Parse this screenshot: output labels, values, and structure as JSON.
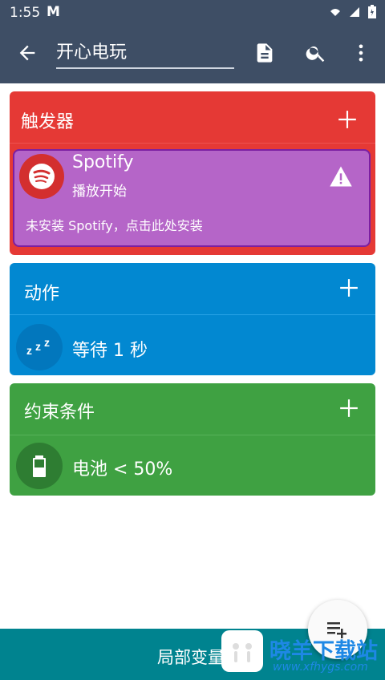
{
  "status_bar": {
    "time": "1:55",
    "app_glyph": "M"
  },
  "app_bar": {
    "title": "开心电玩",
    "icons": [
      "back-arrow-icon",
      "document-icon",
      "search-icon",
      "more-vert-icon"
    ]
  },
  "triggers": {
    "header": "触发器",
    "item": {
      "title": "Spotify",
      "subtitle": "播放开始",
      "note": "未安装 Spotify，点击此处安装",
      "color": "#b565c8"
    }
  },
  "actions": {
    "header": "动作",
    "item": {
      "label": "等待 1 秒",
      "icon": "sleep-zzz-icon"
    }
  },
  "constraints": {
    "header": "约束条件",
    "item": {
      "label": "电池 < 50%",
      "icon": "battery-icon"
    }
  },
  "bottom_bar": {
    "label": "局部变量"
  },
  "watermark": {
    "text": "晓羊下载站",
    "url": "www.xfhygs.com"
  },
  "colors": {
    "appbar": "#3e4e65",
    "trigger": "#e53935",
    "action": "#0288d1",
    "constraint": "#3fa142",
    "bottom": "#00838f"
  }
}
